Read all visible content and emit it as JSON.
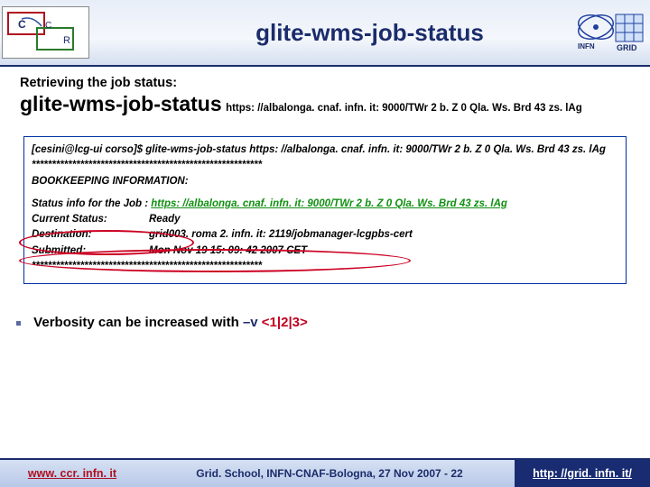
{
  "header": {
    "title": "glite-wms-job-status"
  },
  "content": {
    "retrieve_label": "Retrieving the job status:",
    "command": "glite-wms-job-status",
    "command_url": "https: //albalonga. cnaf. infn. it: 9000/TWr 2 b. Z 0 Qla. Ws. Brd 43 zs. lAg"
  },
  "terminal": {
    "prompt": "[cesini@lcg-ui corso]$",
    "cmd_line": "glite-wms-job-status https: //albalonga. cnaf. infn. it: 9000/TWr 2 b. Z 0 Qla. Ws. Brd 43 zs. lAg",
    "divider": "*********************************************************",
    "bookkeeping": "BOOKKEEPING INFORMATION:",
    "status_intro": "Status info for the Job :",
    "status_url": "https: //albalonga. cnaf. infn. it: 9000/TWr 2 b. Z 0 Qla. Ws. Brd 43 zs. lAg",
    "row_current_key": "Current Status:",
    "row_current_val": "Ready",
    "row_dest_key": "Destination:",
    "row_dest_val": "grid003. roma 2. infn. it: 2119/jobmanager-lcgpbs-cert",
    "row_submitted_key": "Submitted:",
    "row_submitted_val": "Mon Nov 19 15: 09: 42 2007 CET",
    "divider2": "*********************************************************"
  },
  "verbosity": {
    "text_a": "Verbosity can be increased with ",
    "flag": "–v ",
    "vals": "<1|2|3>"
  },
  "footer": {
    "left": "www. ccr. infn. it",
    "mid": "Grid. School, INFN-CNAF-Bologna, 27 Nov 2007  -  22",
    "right": "http: //grid. infn. it/"
  }
}
